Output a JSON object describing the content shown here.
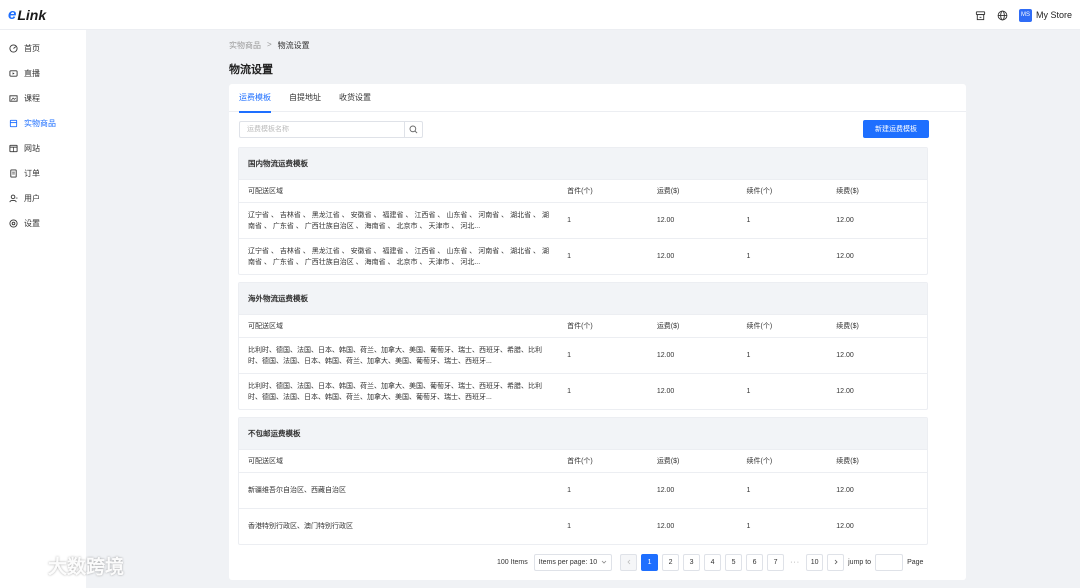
{
  "app": {
    "logo_e": "e",
    "logo_rest": "Link"
  },
  "header": {
    "store_badge": "MS",
    "store_name": "My Store"
  },
  "sidebar": {
    "items": [
      {
        "label": "首页",
        "icon": "dashboard-icon",
        "active": false
      },
      {
        "label": "直播",
        "icon": "live-icon",
        "active": false
      },
      {
        "label": "课程",
        "icon": "course-icon",
        "active": false
      },
      {
        "label": "实物商品",
        "icon": "product-icon",
        "active": true
      },
      {
        "label": "网站",
        "icon": "website-icon",
        "active": false
      },
      {
        "label": "订单",
        "icon": "order-icon",
        "active": false
      },
      {
        "label": "用户",
        "icon": "user-icon",
        "active": false
      },
      {
        "label": "设置",
        "icon": "settings-icon",
        "active": false
      }
    ]
  },
  "breadcrumb": {
    "parent": "实物商品",
    "sep": ">",
    "current": "物流设置"
  },
  "page_title": "物流设置",
  "tabs": [
    {
      "label": "运费模板",
      "active": true
    },
    {
      "label": "自提地址",
      "active": false
    },
    {
      "label": "收货设置",
      "active": false
    }
  ],
  "search": {
    "placeholder": "运费模板名称"
  },
  "new_button": "新建运费模板",
  "columns": [
    "可配送区域",
    "首件(个)",
    "运费($)",
    "续件(个)",
    "续费($)"
  ],
  "sections": [
    {
      "title": "国内物流运费模板",
      "rows": [
        {
          "region": "辽宁省 、 吉林省 、 黑龙江省 、 安徽省 、 福建省 、 江西省 、 山东省 、 河南省 、 湖北省 、 湖南省 、 广东省 、 广西壮族自治区 、 海南省 、 北京市 、 天津市 、 河北...",
          "first": "1",
          "fee": "12.00",
          "next": "1",
          "next_fee": "12.00"
        },
        {
          "region": "辽宁省 、 吉林省 、 黑龙江省 、 安徽省 、 福建省 、 江西省 、 山东省 、 河南省 、 湖北省 、 湖南省 、 广东省 、 广西壮族自治区 、 海南省 、 北京市 、 天津市 、 河北...",
          "first": "1",
          "fee": "12.00",
          "next": "1",
          "next_fee": "12.00"
        }
      ]
    },
    {
      "title": "海外物流运费模板",
      "rows": [
        {
          "region": "比利时、德国、法国、日本、韩国、荷兰、加拿大、美国、葡萄牙、瑞士、西班牙、希腊、比利时、德国、法国、日本、韩国、荷兰、加拿大、美国、葡萄牙、瑞士、西班牙...",
          "first": "1",
          "fee": "12.00",
          "next": "1",
          "next_fee": "12.00"
        },
        {
          "region": "比利时、德国、法国、日本、韩国、荷兰、加拿大、美国、葡萄牙、瑞士、西班牙、希腊、比利时、德国、法国、日本、韩国、荷兰、加拿大、美国、葡萄牙、瑞士、西班牙...",
          "first": "1",
          "fee": "12.00",
          "next": "1",
          "next_fee": "12.00"
        }
      ]
    },
    {
      "title": "不包邮运费模板",
      "rows": [
        {
          "region": "新疆维吾尔自治区、西藏自治区",
          "first": "1",
          "fee": "12.00",
          "next": "1",
          "next_fee": "12.00"
        },
        {
          "region": "香港特别行政区、澳门特别行政区",
          "first": "1",
          "fee": "12.00",
          "next": "1",
          "next_fee": "12.00"
        }
      ]
    }
  ],
  "pagination": {
    "total": "100 Items",
    "page_size": "Items per page: 10",
    "pages": [
      "1",
      "2",
      "3",
      "4",
      "5",
      "6",
      "7"
    ],
    "ellipsis": "···",
    "last": "10",
    "jump_to": "jump to",
    "page_label": "Page"
  },
  "watermark": "大数跨境",
  "colors": {
    "accent": "#1e6fff",
    "background": "#f0f2f5"
  }
}
